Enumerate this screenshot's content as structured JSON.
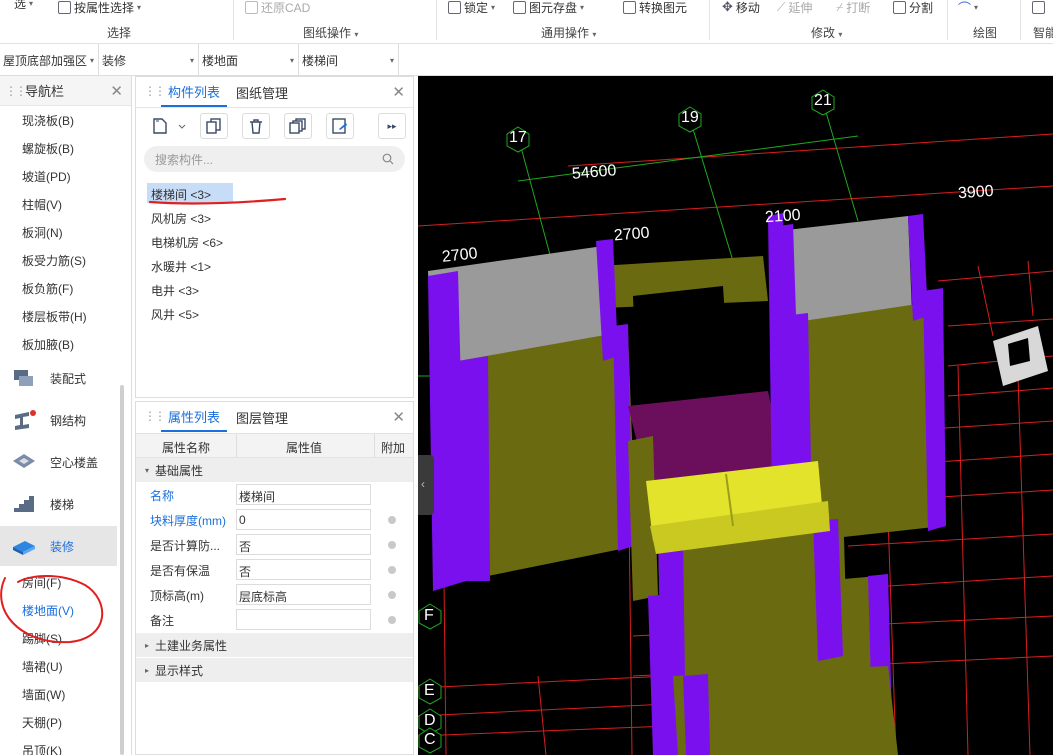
{
  "ribbon": {
    "select_partial": "选",
    "by_attr_select": "按属性选择",
    "restore_cad": "还原CAD",
    "lock": "锁定",
    "save_element": "图元存盘",
    "convert_element": "转换图元",
    "move": "移动",
    "extend": "延伸",
    "break": "打断",
    "split": "分割",
    "group_select": "选择",
    "group_drawing_ops": "图纸操作",
    "group_common_ops": "通用操作",
    "group_modify": "修改",
    "group_draw": "绘图",
    "group_smart": "智能"
  },
  "filterbar": {
    "floor": "屋顶底部加强区",
    "category": "装修",
    "type": "楼地面",
    "instance": "楼梯间"
  },
  "nav": {
    "title": "导航栏",
    "items": [
      "现浇板(B)",
      "螺旋板(B)",
      "坡道(PD)",
      "柱帽(V)",
      "板洞(N)",
      "板受力筋(S)",
      "板负筋(F)",
      "楼层板带(H)",
      "板加腋(B)"
    ],
    "categories": [
      "装配式",
      "钢结构",
      "空心楼盖",
      "楼梯",
      "装修"
    ],
    "sub_items": [
      "房间(F)",
      "楼地面(V)",
      "踢脚(S)",
      "墙裙(U)",
      "墙面(W)",
      "天棚(P)",
      "吊顶(K)"
    ]
  },
  "component_panel": {
    "tab_list": "构件列表",
    "tab_drawings": "图纸管理",
    "search_placeholder": "搜索构件...",
    "items": [
      "楼梯间 <3>",
      "风机房 <3>",
      "电梯机房 <6>",
      "水暖井 <1>",
      "电井 <3>",
      "风井 <5>"
    ]
  },
  "props_panel": {
    "tab_props": "属性列表",
    "tab_layers": "图层管理",
    "col_name": "属性名称",
    "col_value": "属性值",
    "col_extra": "附加",
    "group_basic": "基础属性",
    "rows": [
      {
        "name": "名称",
        "value": "楼梯间"
      },
      {
        "name": "块料厚度(mm)",
        "value": "0"
      },
      {
        "name": "是否计算防...",
        "value": "否"
      },
      {
        "name": "是否有保温",
        "value": "否"
      },
      {
        "name": "顶标高(m)",
        "value": "层底标高"
      },
      {
        "name": "备注",
        "value": ""
      }
    ],
    "group_civil": "土建业务属性",
    "group_display": "显示样式"
  },
  "viewport": {
    "axis_labels": [
      "17",
      "19",
      "21",
      "F",
      "E",
      "D",
      "C"
    ],
    "dimensions": [
      "54600",
      "3900",
      "2700",
      "2700",
      "2100"
    ],
    "colors": {
      "column": "#7b10ee",
      "wall": "#6a6a10",
      "floor": "#6b0f5c",
      "stair": "#e3e32c",
      "grid_green": "#1fa81f",
      "grid_red": "#d81e1e"
    }
  },
  "annotations": {
    "highlight_color": "#e02020"
  }
}
